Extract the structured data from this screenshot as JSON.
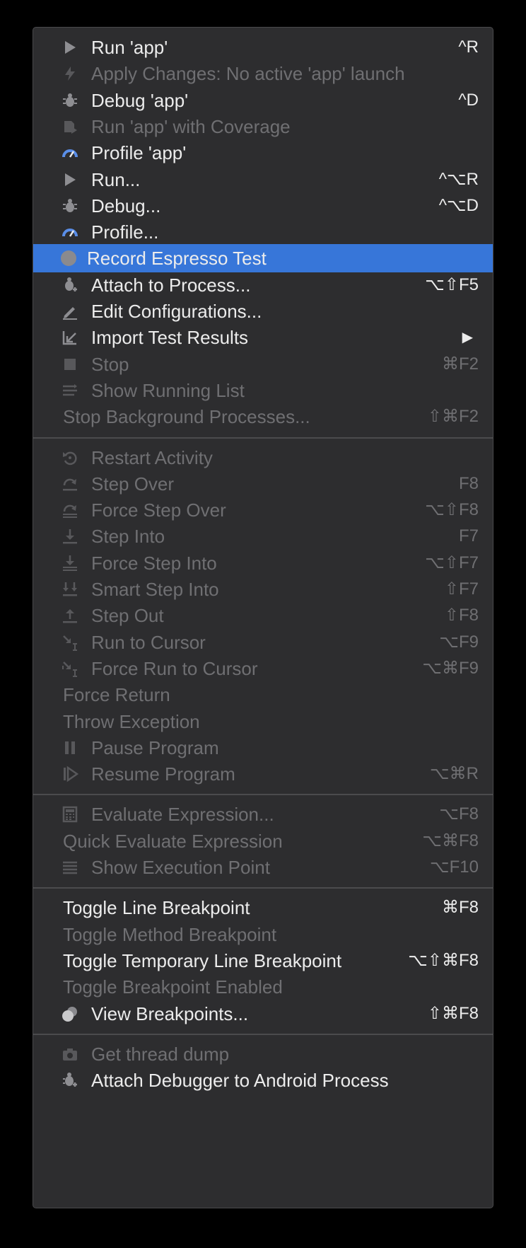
{
  "menu": {
    "items": [
      {
        "label": "Run 'app'",
        "shortcut": "^R",
        "icon": "play-icon",
        "enabled": true
      },
      {
        "label": "Apply Changes: No active 'app' launch",
        "shortcut": "",
        "icon": "lightning-icon",
        "enabled": false
      },
      {
        "label": "Debug 'app'",
        "shortcut": "^D",
        "icon": "bug-icon",
        "enabled": true
      },
      {
        "label": "Run 'app' with Coverage",
        "shortcut": "",
        "icon": "coverage-icon",
        "enabled": false
      },
      {
        "label": "Profile 'app'",
        "shortcut": "",
        "icon": "profiler-gauge-icon",
        "enabled": true
      },
      {
        "label": "Run...",
        "shortcut": "^⌥R",
        "icon": "play-icon",
        "enabled": true
      },
      {
        "label": "Debug...",
        "shortcut": "^⌥D",
        "icon": "bug-icon",
        "enabled": true
      },
      {
        "label": "Profile...",
        "shortcut": "",
        "icon": "profiler-gauge-icon",
        "enabled": true
      },
      {
        "label": "Record Espresso Test",
        "shortcut": "",
        "icon": "record-circle-icon",
        "enabled": true,
        "highlighted": true
      },
      {
        "label": "Attach to Process...",
        "shortcut": "⌥⇧F5",
        "icon": "attach-bug-icon",
        "enabled": true
      },
      {
        "label": "Edit Configurations...",
        "shortcut": "",
        "icon": "edit-pencil-icon",
        "enabled": true
      },
      {
        "label": "Import Test Results",
        "shortcut": "▶",
        "icon": "import-arrow-icon",
        "enabled": true
      },
      {
        "label": "Stop",
        "shortcut": "⌘F2",
        "icon": "stop-square-icon",
        "enabled": false
      },
      {
        "label": "Show Running List",
        "shortcut": "",
        "icon": "running-list-icon",
        "enabled": false
      },
      {
        "label": "Stop Background Processes...",
        "shortcut": "⇧⌘F2",
        "icon": "",
        "enabled": false
      },
      {
        "separator": true
      },
      {
        "label": "Restart Activity",
        "shortcut": "",
        "icon": "restart-icon",
        "enabled": false
      },
      {
        "label": "Step Over",
        "shortcut": "F8",
        "icon": "step-over-icon",
        "enabled": false
      },
      {
        "label": "Force Step Over",
        "shortcut": "⌥⇧F8",
        "icon": "force-step-over-icon",
        "enabled": false
      },
      {
        "label": "Step Into",
        "shortcut": "F7",
        "icon": "step-into-icon",
        "enabled": false
      },
      {
        "label": "Force Step Into",
        "shortcut": "⌥⇧F7",
        "icon": "force-step-into-icon",
        "enabled": false
      },
      {
        "label": "Smart Step Into",
        "shortcut": "⇧F7",
        "icon": "smart-step-into-icon",
        "enabled": false
      },
      {
        "label": "Step Out",
        "shortcut": "⇧F8",
        "icon": "step-out-icon",
        "enabled": false
      },
      {
        "label": "Run to Cursor",
        "shortcut": "⌥F9",
        "icon": "run-to-cursor-icon",
        "enabled": false
      },
      {
        "label": "Force Run to Cursor",
        "shortcut": "⌥⌘F9",
        "icon": "force-run-to-cursor-icon",
        "enabled": false
      },
      {
        "label": "Force Return",
        "shortcut": "",
        "icon": "",
        "enabled": false
      },
      {
        "label": "Throw Exception",
        "shortcut": "",
        "icon": "",
        "enabled": false
      },
      {
        "label": "Pause Program",
        "shortcut": "",
        "icon": "pause-icon",
        "enabled": false
      },
      {
        "label": "Resume Program",
        "shortcut": "⌥⌘R",
        "icon": "resume-icon",
        "enabled": false
      },
      {
        "separator": true
      },
      {
        "label": "Evaluate Expression...",
        "shortcut": "⌥F8",
        "icon": "calculator-icon",
        "enabled": false
      },
      {
        "label": "Quick Evaluate Expression",
        "shortcut": "⌥⌘F8",
        "icon": "",
        "enabled": false
      },
      {
        "label": "Show Execution Point",
        "shortcut": "⌥F10",
        "icon": "execution-point-icon",
        "enabled": false
      },
      {
        "separator": true
      },
      {
        "label": "Toggle Line Breakpoint",
        "shortcut": "⌘F8",
        "icon": "",
        "enabled": true
      },
      {
        "label": "Toggle Method Breakpoint",
        "shortcut": "",
        "icon": "",
        "enabled": false
      },
      {
        "label": "Toggle Temporary Line Breakpoint",
        "shortcut": "⌥⇧⌘F8",
        "icon": "",
        "enabled": true
      },
      {
        "label": "Toggle Breakpoint Enabled",
        "shortcut": "",
        "icon": "",
        "enabled": false
      },
      {
        "label": "View Breakpoints...",
        "shortcut": "⇧⌘F8",
        "icon": "breakpoints-icon",
        "enabled": true
      },
      {
        "separator": true
      },
      {
        "label": "Get thread dump",
        "shortcut": "",
        "icon": "camera-icon",
        "enabled": false
      },
      {
        "label": "Attach Debugger to Android Process",
        "shortcut": "",
        "icon": "attach-debugger-icon",
        "enabled": true
      }
    ]
  },
  "colors": {
    "background": "#000000",
    "menu_bg": "#2d2d2f",
    "highlight": "#3776d9",
    "text": "#ececec",
    "disabled_text": "#6f6f72",
    "separator": "#4b4b4d"
  }
}
